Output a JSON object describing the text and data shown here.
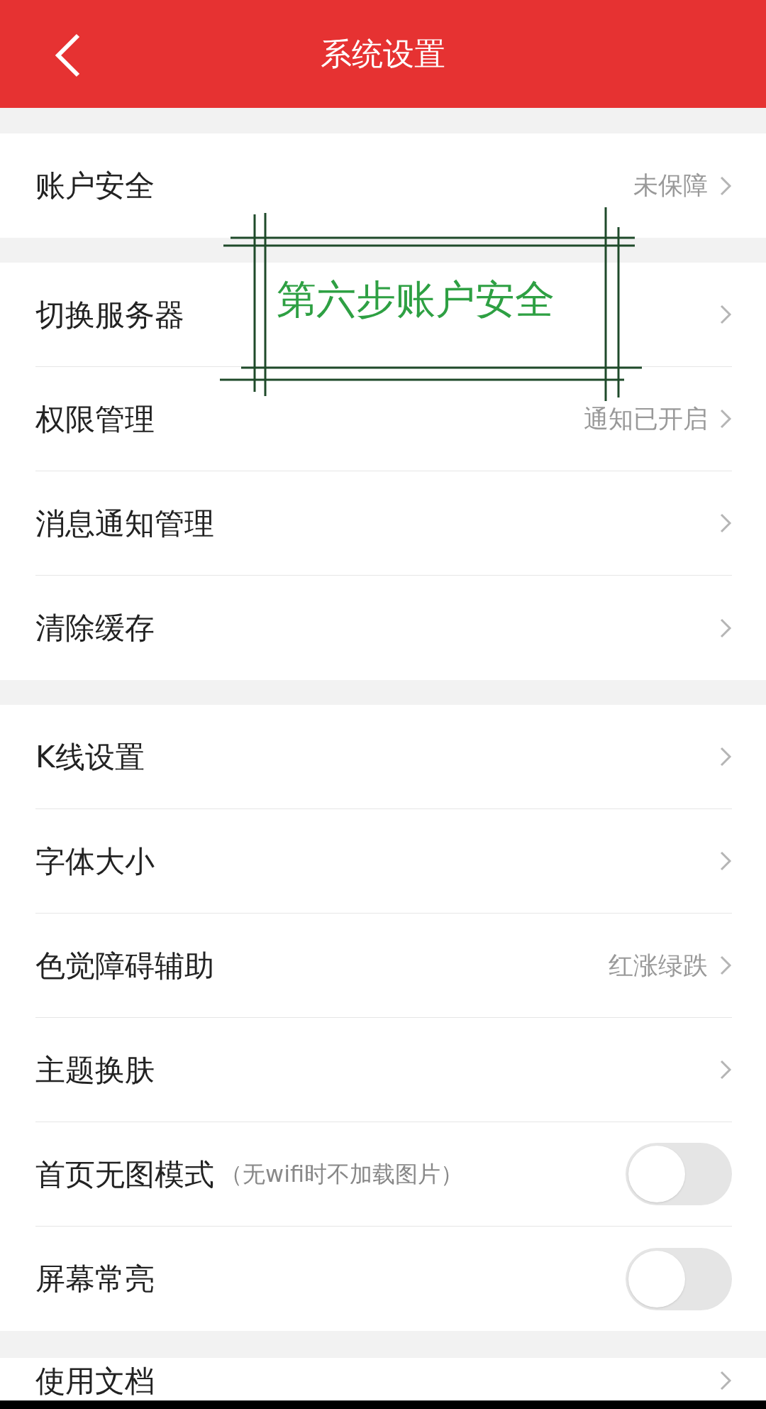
{
  "header": {
    "title": "系统设置"
  },
  "groups": [
    {
      "items": [
        {
          "kind": "nav",
          "label": "账户安全",
          "value": "未保障"
        }
      ]
    },
    {
      "items": [
        {
          "kind": "nav",
          "label": "切换服务器"
        },
        {
          "kind": "nav",
          "label": "权限管理",
          "value": "通知已开启"
        },
        {
          "kind": "nav",
          "label": "消息通知管理"
        },
        {
          "kind": "nav",
          "label": "清除缓存"
        }
      ]
    },
    {
      "items": [
        {
          "kind": "nav",
          "label": "K线设置"
        },
        {
          "kind": "nav",
          "label": "字体大小"
        },
        {
          "kind": "nav",
          "label": "色觉障碍辅助",
          "value": "红涨绿跌"
        },
        {
          "kind": "nav",
          "label": "主题换肤"
        },
        {
          "kind": "toggle",
          "label": "首页无图模式",
          "note": "（无wifi时不加载图片）",
          "on": false
        },
        {
          "kind": "toggle",
          "label": "屏幕常亮",
          "on": false
        }
      ]
    },
    {
      "items": [
        {
          "kind": "nav",
          "label": "使用文档"
        }
      ]
    }
  ],
  "annotation": {
    "text": "第六步账户安全"
  }
}
